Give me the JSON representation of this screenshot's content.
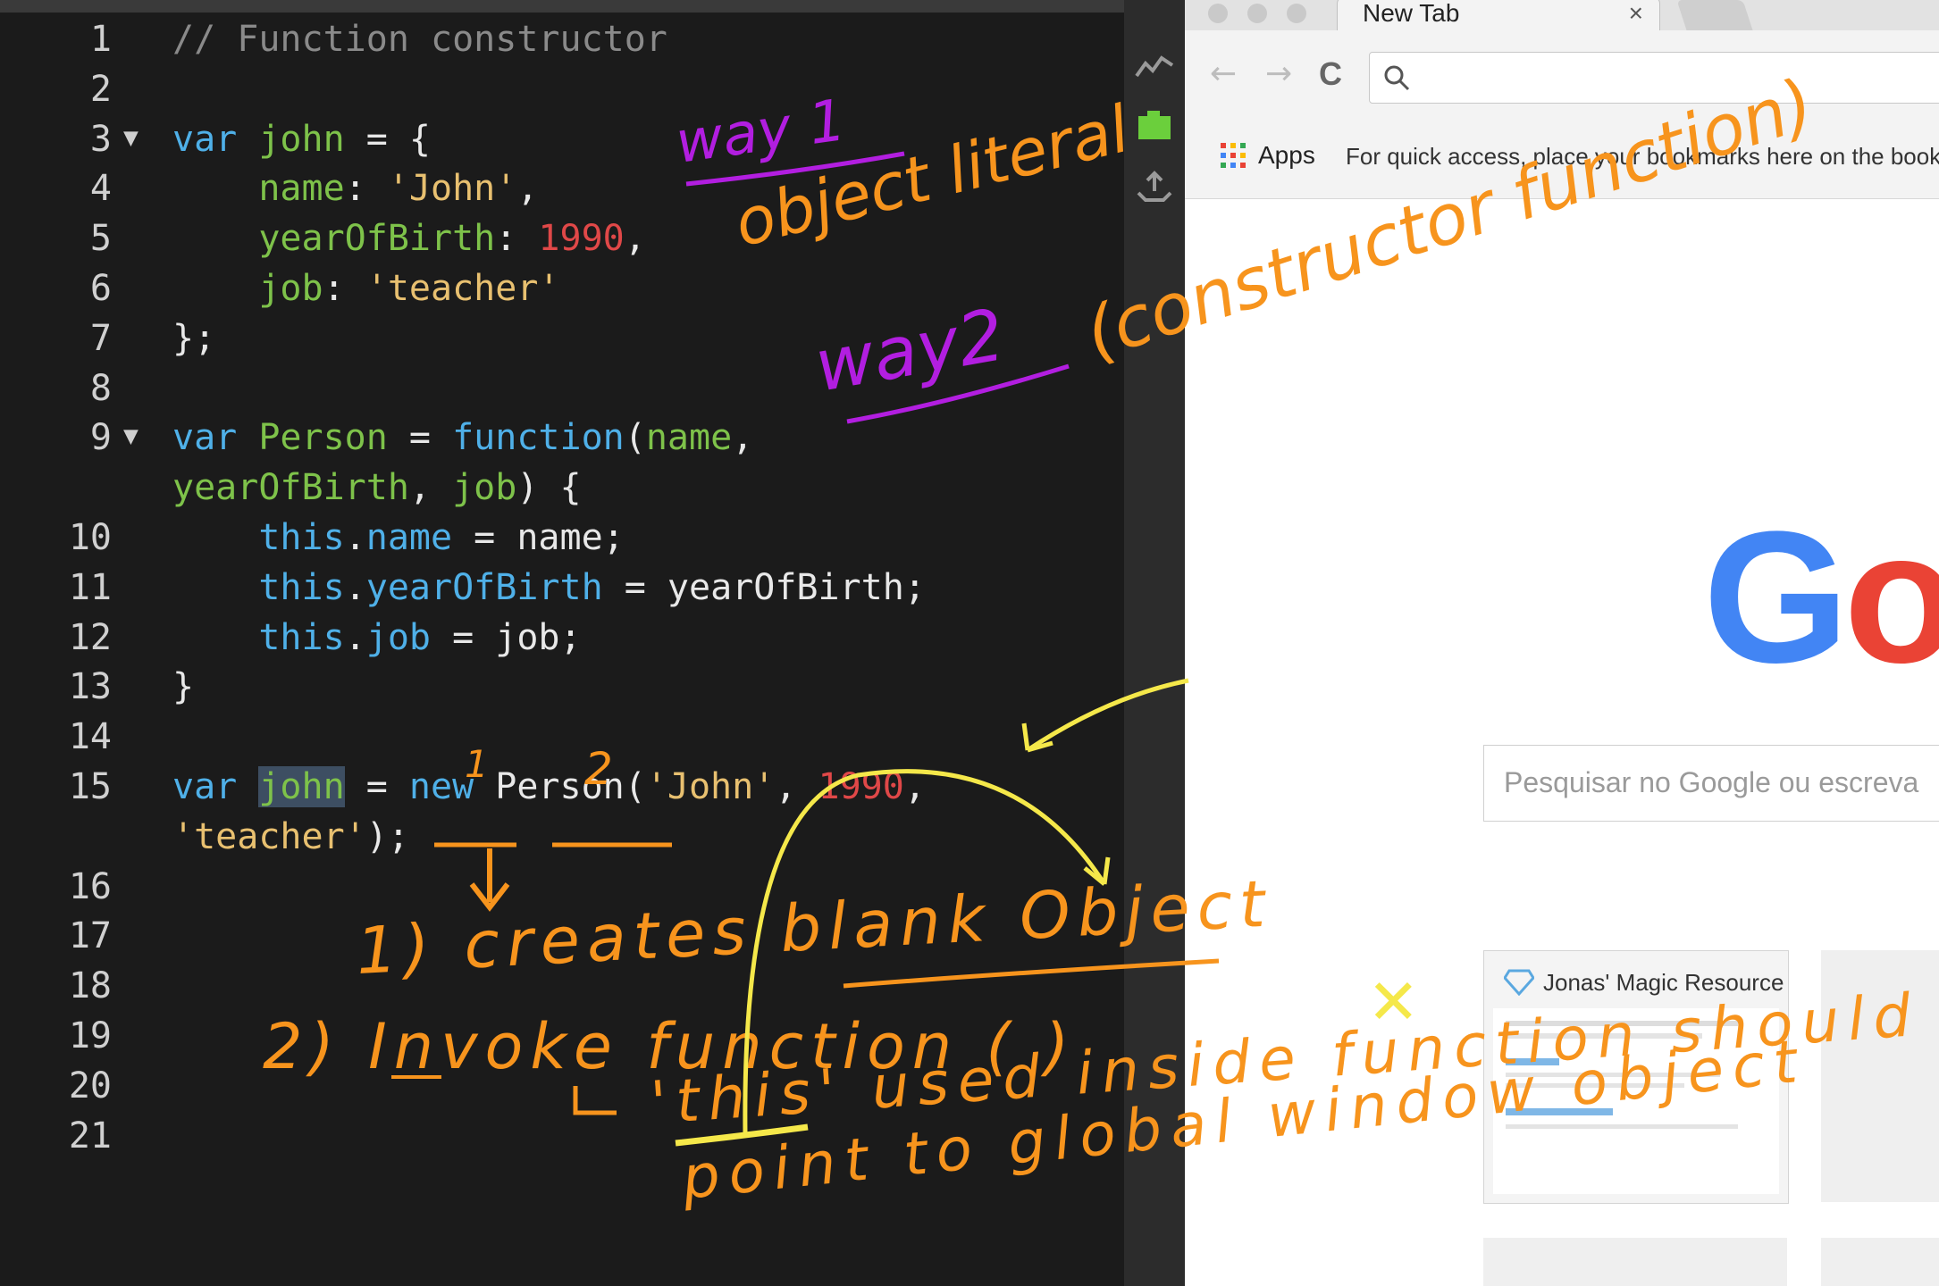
{
  "editor": {
    "lines": [
      {
        "n": "1",
        "fold": false,
        "tokens": [
          {
            "t": "// Function constructor",
            "c": "cmt"
          }
        ]
      },
      {
        "n": "2",
        "fold": false,
        "tokens": []
      },
      {
        "n": "3",
        "fold": true,
        "tokens": [
          {
            "t": "var ",
            "c": "kw"
          },
          {
            "t": "john",
            "c": "id"
          },
          {
            "t": " = {",
            "c": "pl"
          }
        ]
      },
      {
        "n": "4",
        "fold": false,
        "tokens": [
          {
            "t": "    "
          },
          {
            "t": "name",
            "c": "id"
          },
          {
            "t": ": ",
            "c": "pl"
          },
          {
            "t": "'John'",
            "c": "str"
          },
          {
            "t": ",",
            "c": "pl"
          }
        ]
      },
      {
        "n": "5",
        "fold": false,
        "tokens": [
          {
            "t": "    "
          },
          {
            "t": "yearOfBirth",
            "c": "id"
          },
          {
            "t": ": ",
            "c": "pl"
          },
          {
            "t": "1990",
            "c": "num"
          },
          {
            "t": ",",
            "c": "pl"
          }
        ]
      },
      {
        "n": "6",
        "fold": false,
        "tokens": [
          {
            "t": "    "
          },
          {
            "t": "job",
            "c": "id"
          },
          {
            "t": ": ",
            "c": "pl"
          },
          {
            "t": "'teacher'",
            "c": "str"
          }
        ]
      },
      {
        "n": "7",
        "fold": false,
        "tokens": [
          {
            "t": "};",
            "c": "pl"
          }
        ]
      },
      {
        "n": "8",
        "fold": false,
        "tokens": []
      },
      {
        "n": "9",
        "fold": true,
        "tokens": [
          {
            "t": "var ",
            "c": "kw"
          },
          {
            "t": "Person",
            "c": "id"
          },
          {
            "t": " = ",
            "c": "pl"
          },
          {
            "t": "function",
            "c": "kw"
          },
          {
            "t": "(",
            "c": "pl"
          },
          {
            "t": "name",
            "c": "id"
          },
          {
            "t": ",",
            "c": "pl"
          }
        ]
      },
      {
        "n": "",
        "fold": false,
        "tokens": [
          {
            "t": "yearOfBirth",
            "c": "id"
          },
          {
            "t": ", ",
            "c": "pl"
          },
          {
            "t": "job",
            "c": "id"
          },
          {
            "t": ") {",
            "c": "pl"
          }
        ]
      },
      {
        "n": "10",
        "fold": false,
        "tokens": [
          {
            "t": "    "
          },
          {
            "t": "this",
            "c": "kw"
          },
          {
            "t": ".",
            "c": "pl"
          },
          {
            "t": "name",
            "c": "kw"
          },
          {
            "t": " = name;",
            "c": "pl"
          }
        ]
      },
      {
        "n": "11",
        "fold": false,
        "tokens": [
          {
            "t": "    "
          },
          {
            "t": "this",
            "c": "kw"
          },
          {
            "t": ".",
            "c": "pl"
          },
          {
            "t": "yearOfBirth",
            "c": "kw"
          },
          {
            "t": " = yearOfBirth;",
            "c": "pl"
          }
        ]
      },
      {
        "n": "12",
        "fold": false,
        "tokens": [
          {
            "t": "    "
          },
          {
            "t": "this",
            "c": "kw"
          },
          {
            "t": ".",
            "c": "pl"
          },
          {
            "t": "job",
            "c": "kw"
          },
          {
            "t": " = job;",
            "c": "pl"
          }
        ]
      },
      {
        "n": "13",
        "fold": false,
        "tokens": [
          {
            "t": "}",
            "c": "pl"
          }
        ]
      },
      {
        "n": "14",
        "fold": false,
        "tokens": []
      },
      {
        "n": "15",
        "fold": false,
        "tokens": [
          {
            "t": "var ",
            "c": "kw"
          },
          {
            "t": "john",
            "c": "id",
            "hl": true
          },
          {
            "t": " = ",
            "c": "pl"
          },
          {
            "t": "new",
            "c": "kw"
          },
          {
            "t": " Person(",
            "c": "pl"
          },
          {
            "t": "'John'",
            "c": "str"
          },
          {
            "t": ", ",
            "c": "pl"
          },
          {
            "t": "1990",
            "c": "num"
          },
          {
            "t": ",",
            "c": "pl"
          }
        ]
      },
      {
        "n": "",
        "fold": false,
        "tokens": [
          {
            "t": "'teacher'",
            "c": "str"
          },
          {
            "t": ");",
            "c": "pl"
          }
        ]
      },
      {
        "n": "16",
        "fold": false,
        "tokens": []
      },
      {
        "n": "17",
        "fold": false,
        "tokens": []
      },
      {
        "n": "18",
        "fold": false,
        "tokens": []
      },
      {
        "n": "19",
        "fold": false,
        "tokens": []
      },
      {
        "n": "20",
        "fold": false,
        "tokens": []
      },
      {
        "n": "21",
        "fold": false,
        "tokens": []
      }
    ],
    "fold_glyph": "▼"
  },
  "sidebar_icons": [
    "activity-icon",
    "screenshot-icon",
    "upload-icon"
  ],
  "browser": {
    "tab_title": "New Tab",
    "tab_close": "×",
    "back": "←",
    "forward": "→",
    "reload": "C",
    "apps_label": "Apps",
    "bookmarks_hint": "For quick access, place your bookmarks here on the book",
    "logo": [
      {
        "ch": "G",
        "color": "#4285f4"
      },
      {
        "ch": "o",
        "color": "#ea4335"
      }
    ],
    "search_placeholder": "Pesquisar no Google ou escreva",
    "tile_title": "Jonas' Magic Resources"
  },
  "annotations": {
    "way1": "way 1",
    "object_literal": "object literal",
    "way2": "way2",
    "constructor_function": "(constructor function)",
    "num1": "1",
    "num2": "2",
    "step1": "1) creates blank Object",
    "step2": "2) Invoke function ( )",
    "this_used": "'this' used inside function should",
    "point_to": "point to global window object",
    "cross": "✕"
  },
  "colors": {
    "editor_bg": "#1b1b1b",
    "keyword": "#4fb0e8",
    "identifier": "#7ec24a",
    "string": "#e8c070",
    "number": "#e04848",
    "comment": "#8a8a8a",
    "ink_orange": "#f7941d",
    "ink_purple": "#b21ee0",
    "ink_yellow": "#f5e84a"
  }
}
